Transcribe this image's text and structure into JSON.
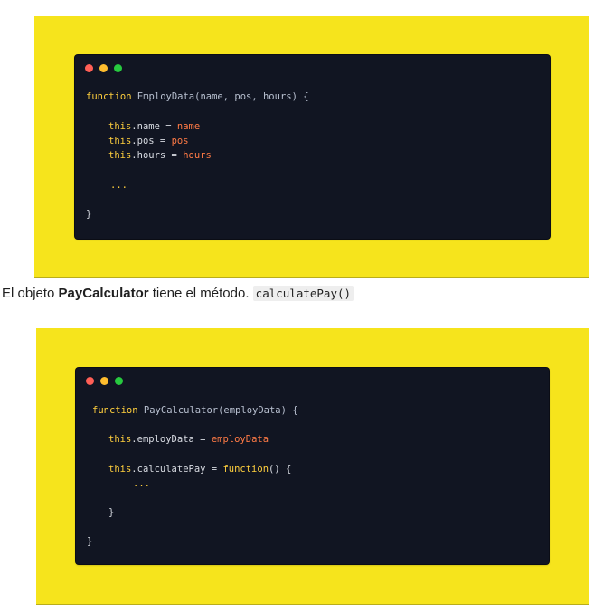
{
  "snippet1": {
    "fn_keyword": "function",
    "fn_name": "EmployData",
    "params": "(name, pos, hours) {",
    "assign": [
      {
        "this": "this",
        "prop": ".name",
        "eq": " = ",
        "val": "name"
      },
      {
        "this": "this",
        "prop": ".pos",
        "eq": " = ",
        "val": "pos"
      },
      {
        "this": "this",
        "prop": ".hours",
        "eq": " = ",
        "val": "hours"
      }
    ],
    "ellipsis": "...",
    "close": "}"
  },
  "caption": {
    "before": "El objeto ",
    "bold": "PayCalculator",
    "after": " tiene el método. ",
    "code": "calculatePay()"
  },
  "snippet2": {
    "fn_keyword": "function",
    "fn_name": "PayCalculator",
    "params": "(employData) {",
    "line1": {
      "this": "this",
      "prop": ".employData",
      "eq": " = ",
      "val": "employData"
    },
    "line2": {
      "this": "this",
      "prop": ".calculatePay",
      "eq": " = ",
      "fn": "function",
      "rest": "() {"
    },
    "ellipsis": "...",
    "inner_close": "}",
    "close": "}"
  },
  "colors": {
    "banner": "#f6e41c",
    "window": "#111522",
    "keyword": "#ffcf3d",
    "value": "#ff7a45",
    "traffic_red": "#ff5f56",
    "traffic_yellow": "#ffbd2e",
    "traffic_green": "#27c93f"
  }
}
